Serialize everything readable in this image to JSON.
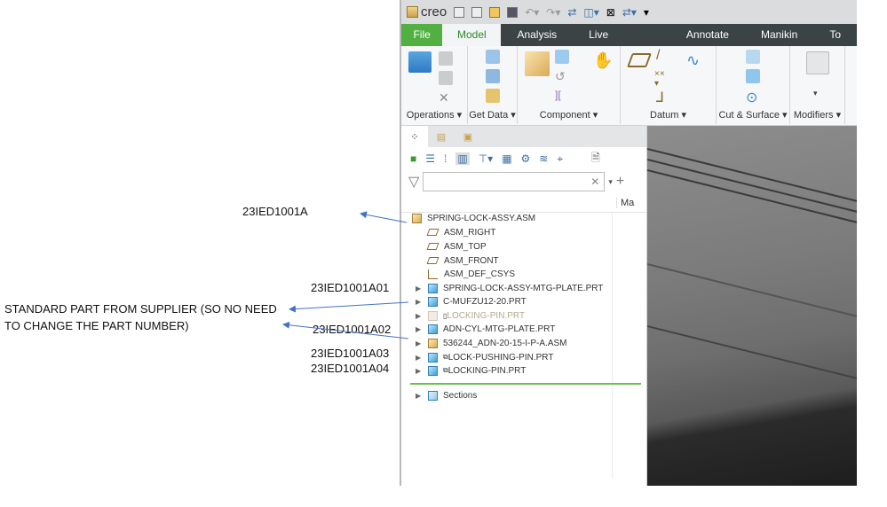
{
  "annotations": {
    "assy": "23IED1001A",
    "a01": "23IED1001A01",
    "standard_line1": "STANDARD PART FROM SUPPLIER (SO NO NEED",
    "standard_line2": "TO CHANGE THE PART NUMBER)",
    "a02": "23IED1001A02",
    "a03": "23IED1001A03",
    "a04": "23IED1001A04",
    "arrow_color": "#4472c4"
  },
  "app": {
    "logo": "creo"
  },
  "tabs": [
    "File",
    "Model",
    "Analysis",
    "Live Simulation",
    "Annotate",
    "Manikin",
    "To"
  ],
  "ribbon_groups": [
    "Operations",
    "Get Data",
    "Component",
    "Datum",
    "Cut & Surface",
    "Modifiers"
  ],
  "tree": {
    "column_header": "Ma",
    "root": "SPRING-LOCK-ASSY.ASM",
    "datums": [
      "ASM_RIGHT",
      "ASM_TOP",
      "ASM_FRONT",
      "ASM_DEF_CSYS"
    ],
    "components": [
      {
        "name": "SPRING-LOCK-ASSY-MTG-PLATE.PRT",
        "type": "part"
      },
      {
        "name": "C-MUFZU12-20.PRT",
        "type": "part"
      },
      {
        "name": "LOCKING-PIN.PRT",
        "type": "suppressed"
      },
      {
        "name": "ADN-CYL-MTG-PLATE.PRT",
        "type": "part"
      },
      {
        "name": "536244_ADN-20-15-I-P-A.ASM",
        "type": "asm"
      },
      {
        "name": "LOCK-PUSHING-PIN.PRT",
        "type": "part"
      },
      {
        "name": "LOCKING-PIN.PRT",
        "type": "part"
      }
    ],
    "sections": "Sections"
  }
}
